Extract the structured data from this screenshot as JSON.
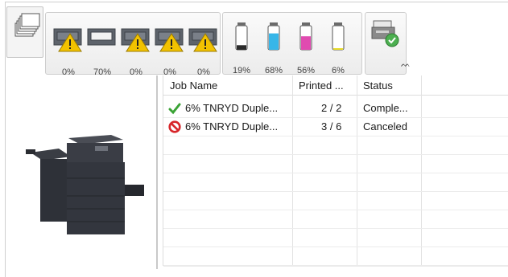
{
  "colors": {
    "warning": "#f2c200",
    "cyan": "#37b6e8",
    "magenta": "#e04bb0",
    "yellow": "#e8dc2a",
    "black": "#2b2b2b",
    "ok_green": "#3aa335",
    "cancel_red": "#d7262a"
  },
  "paper_trays": [
    {
      "name": "tray-1",
      "percent": "0%",
      "warning": true
    },
    {
      "name": "tray-2",
      "percent": "70%",
      "warning": false
    },
    {
      "name": "tray-3",
      "percent": "0%",
      "warning": true
    },
    {
      "name": "tray-4",
      "percent": "0%",
      "warning": true
    },
    {
      "name": "tray-5",
      "percent": "0%",
      "warning": true
    }
  ],
  "toners": [
    {
      "color_name": "black",
      "percent": "19%",
      "level": 0.19
    },
    {
      "color_name": "cyan",
      "percent": "68%",
      "level": 0.68
    },
    {
      "color_name": "magenta",
      "percent": "56%",
      "level": 0.56
    },
    {
      "color_name": "yellow",
      "percent": "6%",
      "level": 0.06
    }
  ],
  "table": {
    "columns": [
      "Job Name",
      "Printed ...",
      "Status"
    ],
    "rows": [
      {
        "icon": "checkmark-icon",
        "job_name": "6% TNRYD Duple...",
        "printed": "2 / 2",
        "status": "Comple..."
      },
      {
        "icon": "cancel-icon",
        "job_name": "6% TNRYD Duple...",
        "printed": "3 / 6",
        "status": "Canceled"
      }
    ]
  },
  "collapse_glyph": "ᨓ"
}
